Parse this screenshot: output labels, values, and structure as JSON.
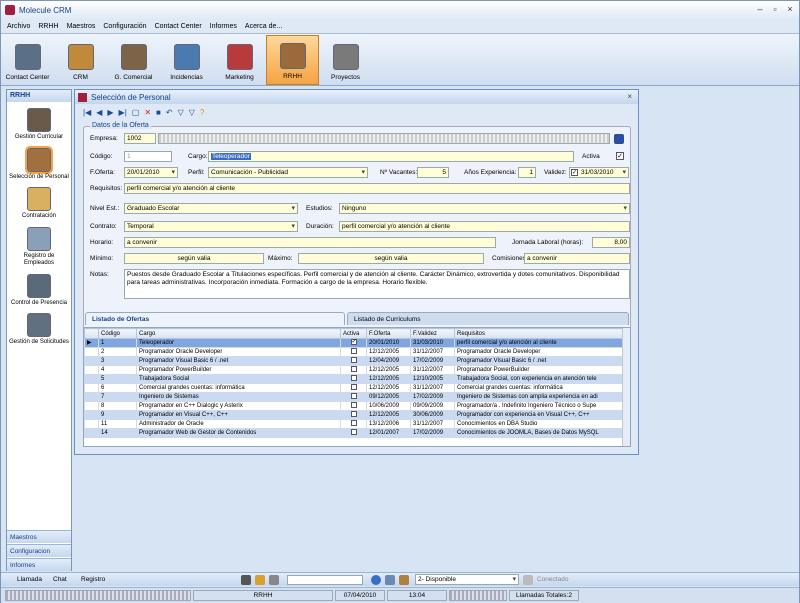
{
  "window_title": "Molecule CRM",
  "menu": [
    "Archivo",
    "RRHH",
    "Maestros",
    "Configuración",
    "Contact Center",
    "Informes",
    "Acerca de..."
  ],
  "ribbon": [
    {
      "label": "Contact Center",
      "icon": "contact-center-icon",
      "color": "#5b6f86"
    },
    {
      "label": "CRM",
      "icon": "crm-users-icon",
      "color": "#c08a3a"
    },
    {
      "label": "G. Comercial",
      "icon": "comercial-icon",
      "color": "#7d6448"
    },
    {
      "label": "Incidencias",
      "icon": "incidencias-icon",
      "color": "#4a7ab0"
    },
    {
      "label": "Marketing",
      "icon": "marketing-icon",
      "color": "#b83a3a"
    },
    {
      "label": "RRHH",
      "icon": "rrhh-icon",
      "color": "#9a6a3a",
      "active": true
    },
    {
      "label": "Proyectos",
      "icon": "proyectos-icon",
      "color": "#7a7a7a"
    }
  ],
  "nav": {
    "header": "RRHH",
    "items": [
      {
        "label": "Gestión Curricular",
        "icon": "gestion-curricular-icon",
        "color": "#6a5a4a"
      },
      {
        "label": "Selección de Personal",
        "icon": "seleccion-personal-icon",
        "color": "#a07040",
        "active": true
      },
      {
        "label": "Contratación",
        "icon": "contratacion-icon",
        "color": "#d9b060"
      },
      {
        "label": "Registro de Empleados",
        "icon": "registro-empleados-icon",
        "color": "#8aa0b8"
      },
      {
        "label": "Control de Presencia",
        "icon": "control-presencia-icon",
        "color": "#5a6a7a"
      },
      {
        "label": "Gestión de Solicitudes",
        "icon": "gestion-solicitudes-icon",
        "color": "#607080"
      }
    ],
    "bottom": [
      "Maestros",
      "Configuracion",
      "Informes"
    ]
  },
  "form": {
    "title": "Selección de Personal",
    "legend": "Datos de la Oferta",
    "labels": {
      "empresa": "Empresa:",
      "codigo": "Código:",
      "cargo": "Cargo:",
      "activa": "Activa",
      "foferta": "F.Oferta:",
      "perfil": "Perfil:",
      "vacantes": "Nº Vacantes:",
      "experiencia": "Años Experiencia:",
      "validez": "Validez:",
      "requisitos": "Requisitos:",
      "nivel": "Nivel Est.:",
      "estudios": "Estudios:",
      "contrato": "Contrato:",
      "duracion": "Duración:",
      "horario": "Horario:",
      "jornada": "Jornada Laboral (horas):",
      "minimo": "Mínimo:",
      "maximo": "Máximo:",
      "comisiones": "Comisiones:",
      "notas": "Notas:"
    },
    "values": {
      "empresa": "1002",
      "codigo": "1",
      "cargo": "Teleoperador",
      "activa": "✓",
      "foferta": "20/01/2010",
      "perfil": "Comunicación - Publicidad",
      "vacantes": "5",
      "experiencia": "1",
      "validez": "31/03/2010",
      "validez_check": "✓",
      "requisitos": "perfil comercial y/o atención al cliente",
      "nivel": "Graduado Escolar",
      "estudios": "Ninguno",
      "contrato": "Temporal",
      "duracion": "perfil comercial y/o atención al cliente",
      "horario": "a convenir",
      "jornada": "8,00",
      "minimo": "según valia",
      "maximo": "según valia",
      "comisiones": "a convenir",
      "notas": "Puestos desde Graduado Escolar a Titulaciones específicas. Perfil comercial y de atención al cliente. Carácter Dinámico, extrovertida y dotes comunitativos. Disponibilidad para tareas administrativas. Incorporación inmediata. Formación a cargo de la empresa. Horario flexible."
    }
  },
  "tabs": [
    "Listado de Ofertas",
    "Listado de Curriculums"
  ],
  "grid": {
    "headers": [
      "",
      "Código",
      "Cargo",
      "Activa",
      "F.Oferta",
      "F.Validez",
      "Requisitos"
    ],
    "rows": [
      {
        "codigo": "1",
        "cargo": "Teleoperador",
        "activa": "✓",
        "foferta": "20/01/2010",
        "fvalidez": "31/03/2010",
        "requisitos": "perfil comercial y/o atención al cliente"
      },
      {
        "codigo": "2",
        "cargo": "Programador Oracle Developer",
        "activa": "",
        "foferta": "12/12/2005",
        "fvalidez": "31/12/2007",
        "requisitos": "Programador Oracle Developer"
      },
      {
        "codigo": "3",
        "cargo": "Programador Visual Basic 6 / .net",
        "activa": "",
        "foferta": "12/04/2009",
        "fvalidez": "17/02/2009",
        "requisitos": "Programador Visual Basic 6 / .net"
      },
      {
        "codigo": "4",
        "cargo": "Programador PowerBuilder",
        "activa": "",
        "foferta": "12/12/2005",
        "fvalidez": "31/12/2007",
        "requisitos": "Programador PowerBuilder"
      },
      {
        "codigo": "5",
        "cargo": "Trabajadora Social",
        "activa": "",
        "foferta": "12/12/2005",
        "fvalidez": "12/10/2005",
        "requisitos": "Trabajadora Social, con experiencia en atención tele"
      },
      {
        "codigo": "6",
        "cargo": "Comercial grandes cuentas: informática",
        "activa": "",
        "foferta": "12/12/2005",
        "fvalidez": "31/12/2007",
        "requisitos": "Comercial grandes cuentas: informática"
      },
      {
        "codigo": "7",
        "cargo": "Ingeniero de Sistemas",
        "activa": "",
        "foferta": "09/12/2005",
        "fvalidez": "17/02/2009",
        "requisitos": "Ingeniero de Sistemas con amplia experiencia en adi"
      },
      {
        "codigo": "8",
        "cargo": "Programador en C++ Dialogic y Asterix",
        "activa": "",
        "foferta": "10/06/2009",
        "fvalidez": "09/09/2009",
        "requisitos": "Programador/a . Indefinito Ingeniero Técnico o Supe"
      },
      {
        "codigo": "9",
        "cargo": "Programador en Visual C++, C++",
        "activa": "",
        "foferta": "12/12/2005",
        "fvalidez": "30/06/2009",
        "requisitos": "Programador con experiencia en Visual C++, C++"
      },
      {
        "codigo": "11",
        "cargo": "Administrador de Oracle",
        "activa": "",
        "foferta": "13/12/2006",
        "fvalidez": "31/12/2007",
        "requisitos": "Conocimientos en DBA Studio"
      },
      {
        "codigo": "14",
        "cargo": "Programador Web de Gestor de Contenidos",
        "activa": "",
        "foferta": "12/01/2007",
        "fvalidez": "17/02/2009",
        "requisitos": "Conocimientos de JOOMLA, Bases de Datos MySQL"
      }
    ]
  },
  "statusbar": {
    "tabs": [
      "Llamada",
      "Chat",
      "Registro"
    ],
    "disponible": "2- Disponible",
    "conectado": "Conectado",
    "module": "RRHH",
    "date": "07/04/2010",
    "time": "13:04",
    "llamadas": "Llamadas Totales:2"
  }
}
